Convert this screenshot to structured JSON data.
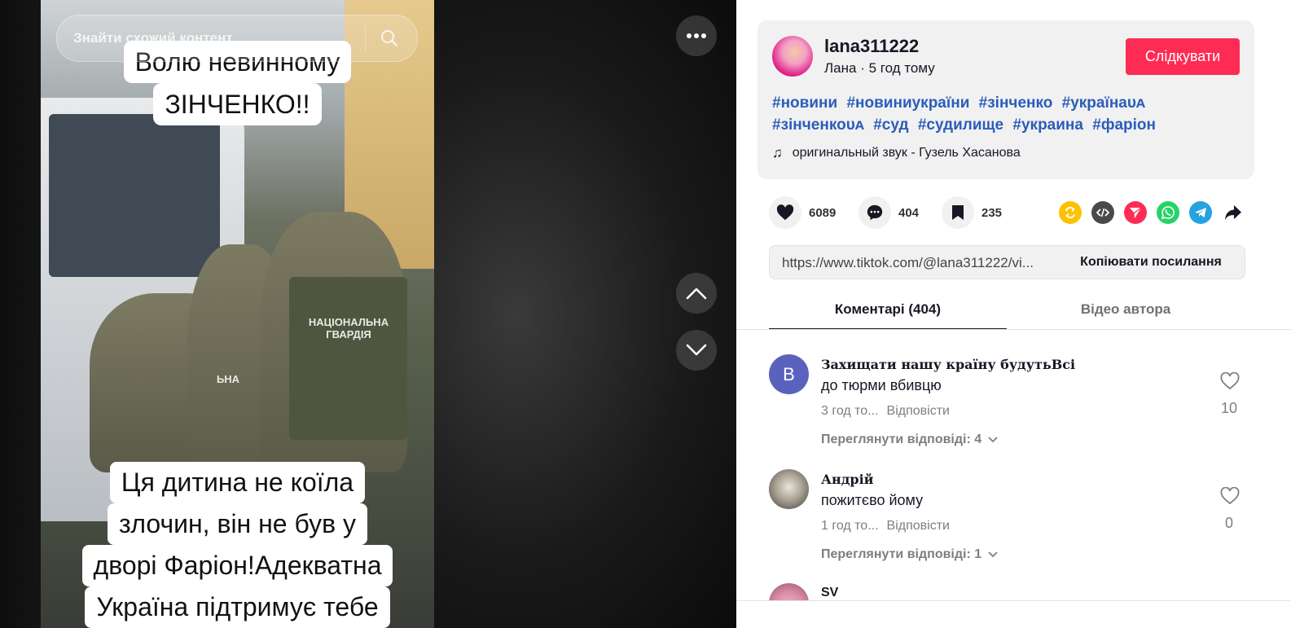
{
  "search": {
    "placeholder": "Знайти схожий контент"
  },
  "video": {
    "overlay_top": [
      "Волю невинному",
      "ЗІНЧЕНКО!!"
    ],
    "overlay_bottom": [
      "Ця дитина не коїла",
      "злочин, він не був у",
      "дворі Фаріон!Адекватна",
      "Україна підтримує тебе"
    ],
    "vest_label": [
      "НАЦІОНАЛЬНА",
      "ГВАРДІЯ"
    ],
    "vest_label_partial": "ЬНА"
  },
  "post": {
    "username": "lana311222",
    "display_name": "Лана",
    "separator": " · ",
    "time_ago": "5 год тому",
    "follow_label": "Слідкувати",
    "hashtags": [
      "#новини",
      "#новиниукраїни",
      "#зінченко",
      "#українаᴜᴀ",
      "#зінченкоᴜᴀ",
      "#суд",
      "#судилище",
      "#украина",
      "#фаріон"
    ],
    "music_icon": "♫",
    "music": "оригинальный звук - Гузель Хасанова"
  },
  "stats": {
    "likes": "6089",
    "comments": "404",
    "saves": "235"
  },
  "share": {
    "link": "https://www.tiktok.com/@lana311222/vi...",
    "copy_label": "Копіювати посилання",
    "icons": [
      "repost-icon",
      "embed-icon",
      "send-icon",
      "whatsapp-icon",
      "telegram-icon",
      "share-arrow-icon"
    ],
    "colors": {
      "repost": "#fcc200",
      "embed": "#4a4a4a",
      "send": "#fe2c55",
      "whatsapp": "#25d366",
      "telegram": "#27a1e0"
    }
  },
  "tabs": {
    "comments": "Коментарі (404)",
    "videos": "Відео автора"
  },
  "comments": [
    {
      "avatar_letter": "В",
      "name": "Захищати нашу країну будутьВсі",
      "text": "до тюрми вбивцю",
      "time": "3 год то...",
      "reply": "Відповісти",
      "likes": "10",
      "more": "Переглянути відповіді: 4"
    },
    {
      "name": "Андрій",
      "text": "пожитєво йому",
      "time": "1 год то...",
      "reply": "Відповісти",
      "likes": "0",
      "more": "Переглянути відповіді: 1"
    },
    {
      "name": "SV"
    }
  ],
  "colors": {
    "follow": "#fe2c55",
    "hashtag": "#2b5db9",
    "letter_avatar": "#5b62bd"
  }
}
